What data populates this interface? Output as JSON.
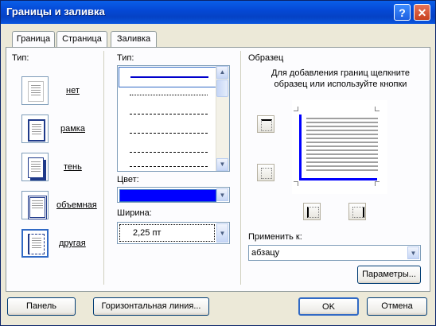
{
  "window": {
    "title": "Границы и заливка"
  },
  "tabs": [
    {
      "label": "Граница",
      "underline": "Г",
      "rest": "раница"
    },
    {
      "label": "Страница",
      "underline": "С",
      "rest": "траница"
    },
    {
      "label": "Заливка",
      "underline": "З",
      "rest": "аливка"
    }
  ],
  "left": {
    "type_label": "Тип:",
    "presets": [
      {
        "label": "нет",
        "icon": "border-none-icon"
      },
      {
        "label": "рамка",
        "icon": "border-box-icon"
      },
      {
        "label": "тень",
        "icon": "border-shadow-icon"
      },
      {
        "label": "объемная",
        "icon": "border-3d-icon"
      },
      {
        "label": "другая",
        "icon": "border-custom-icon"
      }
    ]
  },
  "middle": {
    "type_label": "Тип:",
    "color_label": "Цвет:",
    "width_label": "Ширина:",
    "width_value": "2,25 пт",
    "line_color": "#0000FF"
  },
  "right": {
    "preview_label": "Образец",
    "hint": "Для добавления границ щелкните образец или используйте кнопки",
    "apply_label": "Применить к:",
    "apply_value": "абзацу",
    "params_button": "Параметры..."
  },
  "footer": {
    "panel_button": "Панель",
    "hline_button": "Горизонтальная линия...",
    "ok_button": "OK",
    "cancel_button": "Отмена"
  }
}
